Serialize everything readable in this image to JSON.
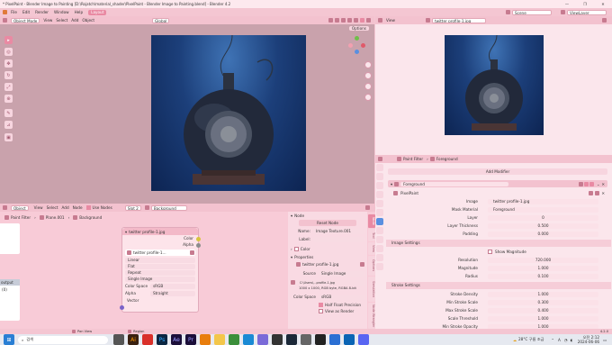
{
  "window": {
    "title": "* PixelPaint - Blender Image to Painting [D:\\Rojatch\\material_shader\\PixelPaint - Blender Image to Painting.blend] - Blender 4.2",
    "controls": [
      "—",
      "❐",
      "✕"
    ]
  },
  "menu": {
    "items": [
      "File",
      "Edit",
      "Render",
      "Window",
      "Help"
    ],
    "active_workspace": "Layout",
    "scene": "Scene",
    "view_layer": "ViewLayer"
  },
  "viewport": {
    "mode": "Object Mode",
    "menus": [
      "View",
      "Select",
      "Add",
      "Object"
    ],
    "transform": "Global",
    "options_label": "Options"
  },
  "image_editor": {
    "view_label": "View",
    "image_name": "twitter profile-1.jpg"
  },
  "properties_header": {
    "filter_label": "Paint Filter",
    "object_label": "Foreground",
    "add_modifier": "Add Modifier",
    "modifier_name": "Foreground",
    "panel_title": "PixelPaint"
  },
  "modifier_props": [
    {
      "label": "Image",
      "value": "twitter profile-1.jpg"
    },
    {
      "label": "Mask Material",
      "value": "Foreground"
    },
    {
      "label": "Layer",
      "value": "0"
    },
    {
      "label": "Layer Thickness",
      "value": "0.500"
    },
    {
      "label": "Padding",
      "value": "0.000"
    }
  ],
  "image_settings": {
    "title": "Image Settings",
    "show_magnitude": "Show Magnitude",
    "props": [
      {
        "label": "Resolution",
        "value": "720.000"
      },
      {
        "label": "Magnitude",
        "value": "1.000"
      },
      {
        "label": "Radius",
        "value": "0.100"
      }
    ]
  },
  "stroke_settings": {
    "title": "Stroke Settings",
    "props": [
      {
        "label": "Stroke Density",
        "value": "1.000"
      },
      {
        "label": "Min Stroke Scale",
        "value": "0.300"
      },
      {
        "label": "Max Stroke Scale",
        "value": "0.400"
      },
      {
        "label": "Scale Threshold",
        "value": "1.000"
      },
      {
        "label": "Min Stroke Opacity",
        "value": "1.000"
      }
    ]
  },
  "node_editor": {
    "type": "Object",
    "menus": [
      "View",
      "Select",
      "Add",
      "Node"
    ],
    "use_nodes": "Use Nodes",
    "slot": "Slot 2",
    "material": "Background",
    "breadcrumb": [
      "Paint Filter",
      "Plane.001",
      "Background"
    ]
  },
  "image_node": {
    "title": "twitter profile-1.jpg",
    "outputs": [
      "Color",
      "Alpha"
    ],
    "image": "twitter profile-1...",
    "interpolation": "Linear",
    "projection": "Flat",
    "extension": "Repeat",
    "source": "Single Image",
    "color_space_label": "Color Space",
    "color_space": "sRGB",
    "alpha_label": "Alpha",
    "alpha": "Straight",
    "vector": "Vector"
  },
  "left_nodes": {
    "output_label": "output",
    "output_value": "(0)"
  },
  "node_sidebar": {
    "section": "Node",
    "reset": "Reset Node",
    "name_label": "Name:",
    "name_value": "Image Texture.001",
    "label_label": "Label:",
    "color": "Color",
    "properties": "Properties",
    "image": "twitter profile-1.jpg",
    "source_label": "Source",
    "source_value": "Single Image",
    "filepath": "C:\\Users\\...profile-1.jpg",
    "info": "1000 x 1000,  RGB byte, RGBA 8-bit",
    "color_space_label": "Color Space",
    "color_space": "sRGB",
    "half_float": "Half Float Precision",
    "view_as_render": "View as Render",
    "tabs": [
      "Node",
      "Tool",
      "View",
      "Options",
      "Simulation",
      "Node Wrangler"
    ]
  },
  "status": {
    "pan_view": "Pan View",
    "region": "Region",
    "version": "4.2.0"
  },
  "taskbar": {
    "search": "검색",
    "weather": "28°C 구름 조금",
    "time": "오전 2:12",
    "date": "2024-06-06",
    "lang": "A"
  }
}
